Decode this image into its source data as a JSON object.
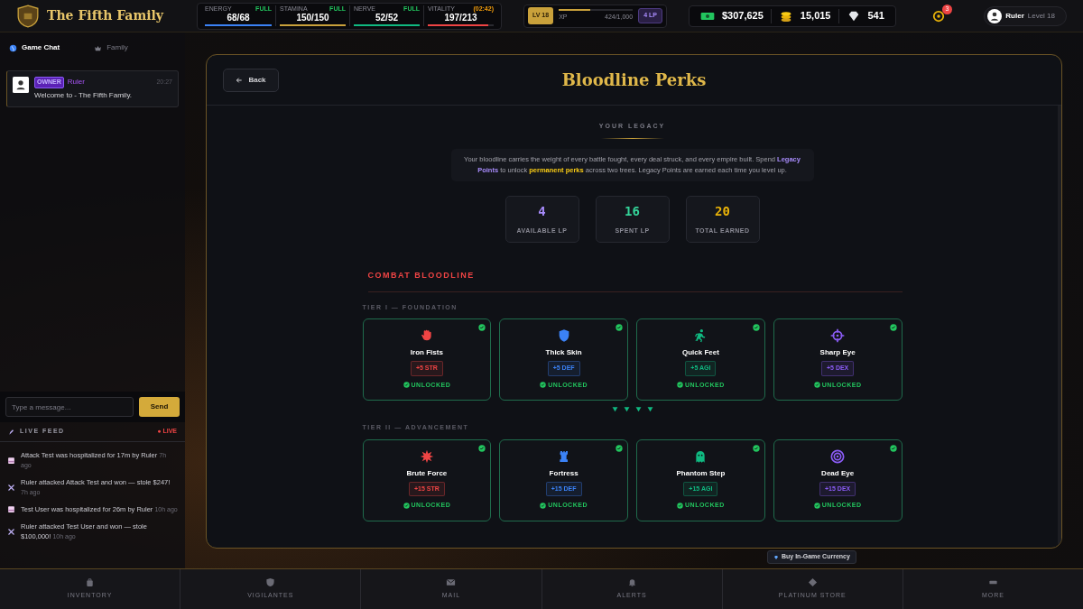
{
  "brand": {
    "title": "The Fifth Family"
  },
  "stats": [
    {
      "label": "ENERGY",
      "status": "FULL",
      "kind": "full",
      "value": "68/68",
      "level": 1,
      "color": "#3b82f6"
    },
    {
      "label": "STAMINA",
      "status": "FULL",
      "kind": "full",
      "value": "150/150",
      "level": 1,
      "color": "#c9a13b"
    },
    {
      "label": "NERVE",
      "status": "FULL",
      "kind": "full",
      "value": "52/52",
      "level": 1,
      "color": "#10b981"
    },
    {
      "label": "VITALITY",
      "status": "(02:42)",
      "kind": "timer",
      "value": "197/213",
      "level": 0.92,
      "color": "#ef4444"
    }
  ],
  "level": {
    "badge": "LV 18",
    "xp_label": "XP",
    "xp_value": "424/1,000",
    "level": 0.42,
    "lp": "4 LP"
  },
  "currency": [
    {
      "kind": "cash",
      "value": "$307,625"
    },
    {
      "kind": "coins",
      "value": "15,015"
    },
    {
      "kind": "diamonds",
      "value": "541"
    }
  ],
  "notifications": {
    "count": "3"
  },
  "profile": {
    "name": "Ruler",
    "level": "Level 18"
  },
  "chat": {
    "tabs": [
      {
        "label": "Game Chat",
        "selected": true
      },
      {
        "label": "Family",
        "selected": false
      }
    ],
    "messages": [
      {
        "role": "OWNER",
        "user": "Ruler",
        "time": "20:27",
        "text": "Welcome to - The Fifth Family."
      }
    ],
    "input": {
      "placeholder": "Type a message..."
    },
    "send": "Send"
  },
  "live_feed": {
    "title": "LIVE FEED",
    "badge": "● LIVE",
    "items": [
      {
        "kind": "hospital",
        "text": "Attack Test was hospitalized for 17m by Ruler",
        "time": "7h ago"
      },
      {
        "kind": "attack",
        "text": "Ruler attacked Attack Test and won — stole $247!",
        "time": "7h ago"
      },
      {
        "kind": "hospital",
        "text": "Test User was hospitalized for 26m by Ruler",
        "time": "10h ago"
      },
      {
        "kind": "attack",
        "text": "Ruler attacked Test User and won — stole $100,000!",
        "time": "10h ago"
      }
    ]
  },
  "page": {
    "back": "Back",
    "title": "Bloodline Perks",
    "legacy_heading": "YOUR LEGACY",
    "intro": "Your bloodline carries the weight of every battle fought, every deal struck, and every empire built. Spend **Legacy Points** to unlock **permanent perks** across two trees. Legacy Points are earned each time you level up.",
    "points": [
      {
        "value": "4",
        "label": "AVAILABLE LP",
        "color": "#a78bfa"
      },
      {
        "value": "16",
        "label": "SPENT LP",
        "color": "#34d399"
      },
      {
        "value": "20",
        "label": "TOTAL EARNED",
        "color": "#eab308"
      }
    ],
    "tree_title": "COMBAT BLOODLINE",
    "tiers": [
      {
        "title": "TIER I — FOUNDATION",
        "perks": [
          {
            "name": "Iron Fists",
            "bonus": "+5 STR",
            "color": "#ef4444",
            "unlocked": true,
            "status": "UNLOCKED"
          },
          {
            "name": "Thick Skin",
            "bonus": "+5 DEF",
            "color": "#3b82f6",
            "unlocked": true,
            "status": "UNLOCKED"
          },
          {
            "name": "Quick Feet",
            "bonus": "+5 AGI",
            "color": "#10b981",
            "unlocked": true,
            "status": "UNLOCKED"
          },
          {
            "name": "Sharp Eye",
            "bonus": "+5 DEX",
            "color": "#8b5cf6",
            "unlocked": true,
            "status": "UNLOCKED"
          }
        ]
      },
      {
        "title": "TIER II — ADVANCEMENT",
        "perks": [
          {
            "name": "Brute Force",
            "bonus": "+15 STR",
            "color": "#ef4444",
            "unlocked": true,
            "status": "UNLOCKED"
          },
          {
            "name": "Fortress",
            "bonus": "+15 DEF",
            "color": "#3b82f6",
            "unlocked": true,
            "status": "UNLOCKED"
          },
          {
            "name": "Phantom Step",
            "bonus": "+15 AGI",
            "color": "#10b981",
            "unlocked": true,
            "status": "UNLOCKED"
          },
          {
            "name": "Dead Eye",
            "bonus": "+15 DEX",
            "color": "#8b5cf6",
            "unlocked": true,
            "status": "UNLOCKED"
          }
        ]
      }
    ]
  },
  "tooltip": "Buy In-Game Currency",
  "nav": [
    {
      "label": "INVENTORY"
    },
    {
      "label": "VIGILANTES"
    },
    {
      "label": "MAIL"
    },
    {
      "label": "ALERTS"
    },
    {
      "label": "PLATINUM STORE"
    },
    {
      "label": "MORE"
    }
  ]
}
